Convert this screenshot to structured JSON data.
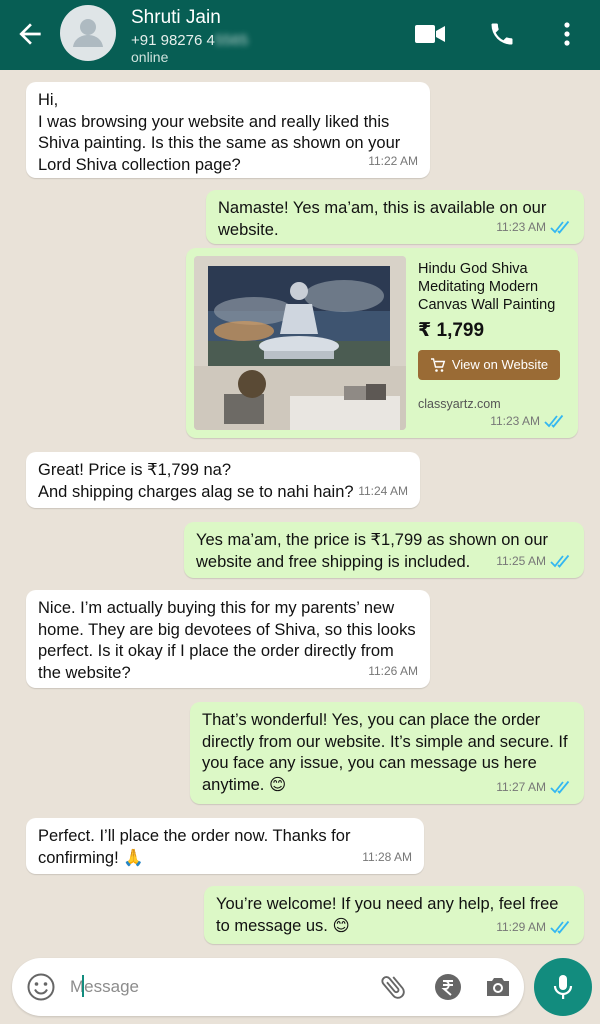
{
  "header": {
    "name": "Shruti Jain",
    "phone_visible": "+91 98276 4",
    "phone_blurred": "5565",
    "status": "online"
  },
  "messages": [
    {
      "dir": "in",
      "text": "Hi,\nI was browsing your website and really liked this Shiva painting. Is this the same as shown on your Lord Shiva collection page?",
      "time": "11:22 AM"
    },
    {
      "dir": "out",
      "text": "Namaste! Yes ma’am, this is available on our website.",
      "time": "11:23 AM"
    },
    {
      "dir": "out",
      "type": "product",
      "time": "11:23 AM"
    },
    {
      "dir": "in",
      "text": "Great! Price is ₹1,799 na?\nAnd shipping charges alag se to nahi hain?",
      "time": "11:24 AM"
    },
    {
      "dir": "out",
      "text": "Yes ma’am, the price is ₹1,799 as shown on our website and free shipping is included.",
      "time": "11:25 AM"
    },
    {
      "dir": "in",
      "text": "Nice. I’m actually buying this for my parents’ new home. They are big devotees of Shiva, so this looks perfect. Is it okay if I place the order directly from the website?",
      "time": "11:26 AM"
    },
    {
      "dir": "out",
      "text": "That’s wonderful! Yes, you can place the order directly from our website. It’s simple and secure. If you face any issue, you can message us here anytime. 😊",
      "time": "11:27 AM"
    },
    {
      "dir": "in",
      "text": "Perfect. I’ll place the order now. Thanks for confirming! 🙏",
      "time": "11:28 AM"
    },
    {
      "dir": "out",
      "text": "You’re welcome! If you need any help, feel free to message us. 😊",
      "time": "11:29 AM"
    }
  ],
  "product": {
    "title": "Hindu God Shiva Meditating Modern Canvas Wall Painting",
    "price": "₹ 1,799",
    "button": "View on Website",
    "domain": "classyartz.com"
  },
  "composer": {
    "placeholder": "Message"
  },
  "colors": {
    "header": "#075e54",
    "outgoing": "#dcf8c6",
    "incoming": "#ffffff",
    "accent": "#128c7e",
    "read_ticks": "#34b7f1"
  },
  "icons": [
    "back-arrow-icon",
    "avatar-icon",
    "video-call-icon",
    "phone-icon",
    "more-vert-icon",
    "emoji-icon",
    "attach-icon",
    "rupee-icon",
    "camera-icon",
    "mic-icon",
    "double-tick-icon",
    "cart-icon"
  ]
}
